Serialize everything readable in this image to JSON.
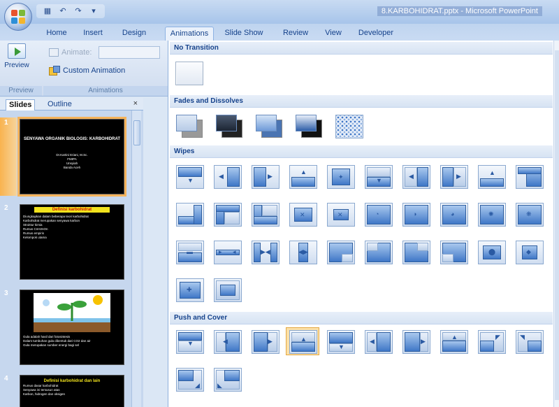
{
  "window": {
    "title": "8.KARBOHIDRAT.pptx - Microsoft PowerPoint"
  },
  "ribbon": {
    "tabs": [
      "Home",
      "Insert",
      "Design",
      "Animations",
      "Slide Show",
      "Review",
      "View",
      "Developer"
    ],
    "active_tab": "Animations",
    "preview_label": "Preview",
    "animate_label": "Animate:",
    "custom_animation_label": "Custom Animation",
    "group_preview": "Preview",
    "group_animations": "Animations"
  },
  "slides_panel": {
    "tabs": [
      "Slides",
      "Outline"
    ],
    "active_tab": "Slides",
    "close": "×",
    "slides": [
      {
        "number": "1",
        "title": "SENYAWA ORGANIK BIOLOGIS: KARBOHIDRAT",
        "subtitle": "Dr.Kartini Eriani, M.Sc.\nFMIPA\nUnsyiah\nBanda Aceh"
      },
      {
        "number": "2",
        "title": "Definisi karbohidrat",
        "bullets": [
          "Diungkapkan dalam beberapa teori karbohidrat",
          "Karbohidrat merupakan senyawa karbon",
          "Struktur kimia",
          "Rumus CnH2nOn",
          "Rumus empiris",
          "Kelompok utama"
        ]
      },
      {
        "number": "3",
        "bullets": [
          "Gula adalah hasil dari fotosintesis",
          "Dalam tumbuhan gula dibentuk dari CO2 dan air",
          "Gula merupakan sumber energi bagi sel"
        ]
      },
      {
        "number": "4",
        "title": "Definisi karbohidrat dan lain",
        "bullets": [
          "Rumus dasar karbohidrat",
          "Senyawa ini tersusun atas",
          "Karbon, hidrogen dan oksigen"
        ]
      }
    ]
  },
  "gallery": {
    "sections": [
      {
        "name": "No Transition"
      },
      {
        "name": "Fades and Dissolves"
      },
      {
        "name": "Wipes"
      },
      {
        "name": "Push and Cover"
      }
    ],
    "selected_effect": "push-cover-4"
  },
  "colors": {
    "accent": "#15428b",
    "selection": "#fbe0a8",
    "ribbon_bg": "#dbe7f5"
  }
}
